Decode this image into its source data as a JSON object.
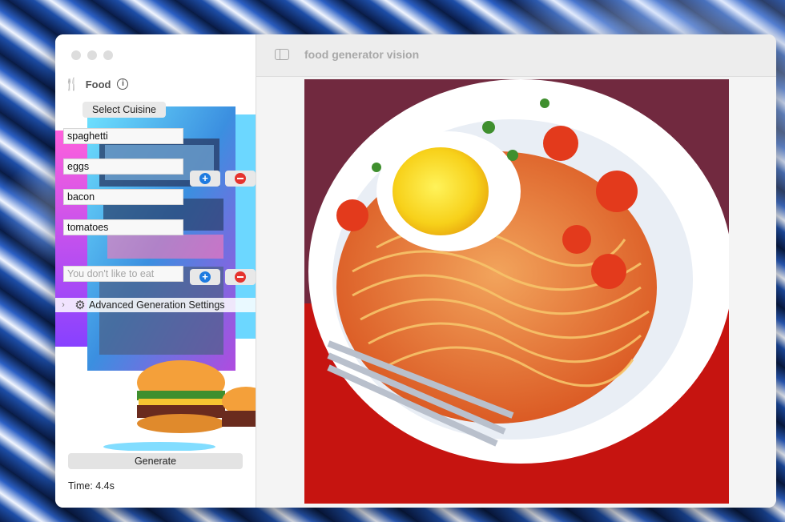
{
  "window": {
    "title": "food generator vision"
  },
  "sidebar": {
    "section_title": "Food",
    "select_cuisine_label": "Select Cuisine",
    "ingredients": [
      "spaghetti",
      "eggs",
      "bacon",
      "tomatoes"
    ],
    "dislike_placeholder": "You don't like to eat",
    "add_symbol": "+",
    "advanced_label": "Advanced Generation Settings",
    "generate_label": "Generate",
    "time_text": "Time: 4.4s"
  },
  "icons": {
    "fork": "fork-knife-icon",
    "info": "info-icon",
    "gear": "gear-icon",
    "sidebar_toggle": "sidebar-toggle-icon"
  },
  "colors": {
    "add_blue": "#1e7be0",
    "remove_red": "#e5332e"
  }
}
